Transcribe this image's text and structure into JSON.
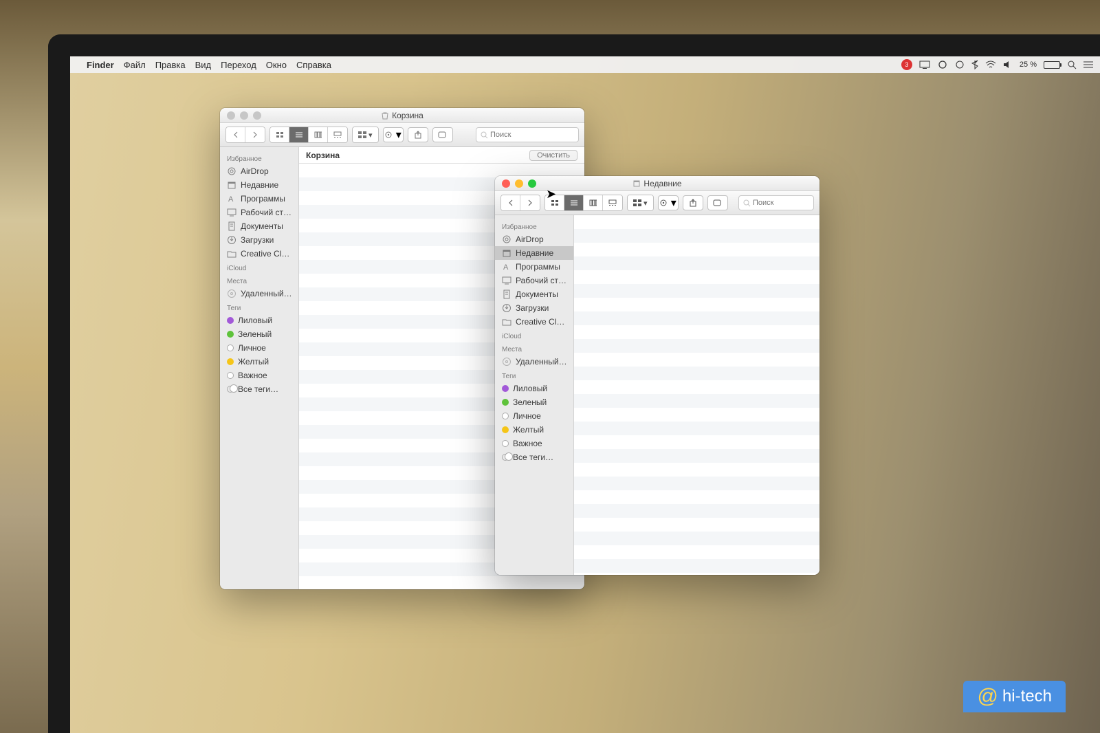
{
  "menubar": {
    "app": "Finder",
    "items": [
      "Файл",
      "Правка",
      "Вид",
      "Переход",
      "Окно",
      "Справка"
    ],
    "notification_badge": "3",
    "battery_text": "25 %"
  },
  "search_placeholder": "Поиск",
  "window1": {
    "title": "Корзина",
    "header": "Корзина",
    "clear": "Очистить"
  },
  "window2": {
    "title": "Недавние"
  },
  "sidebar": {
    "favorites_label": "Избранное",
    "favorites": [
      {
        "icon": "airdrop",
        "label": "AirDrop"
      },
      {
        "icon": "recent",
        "label": "Недавние"
      },
      {
        "icon": "apps",
        "label": "Программы"
      },
      {
        "icon": "desktop",
        "label": "Рабочий ст…"
      },
      {
        "icon": "docs",
        "label": "Документы"
      },
      {
        "icon": "downloads",
        "label": "Загрузки"
      },
      {
        "icon": "folder",
        "label": "Creative Cl…"
      }
    ],
    "icloud_label": "iCloud",
    "places_label": "Места",
    "places": [
      {
        "icon": "disk",
        "label": "Удаленный…"
      }
    ],
    "tags_label": "Теги",
    "tags": [
      {
        "color": "purple",
        "label": "Лиловый"
      },
      {
        "color": "green",
        "label": "Зеленый"
      },
      {
        "color": "empty",
        "label": "Личное"
      },
      {
        "color": "yellow",
        "label": "Желтый"
      },
      {
        "color": "empty",
        "label": "Важное"
      },
      {
        "color": "all",
        "label": "Все теги…"
      }
    ]
  },
  "watermark": "hi-tech"
}
